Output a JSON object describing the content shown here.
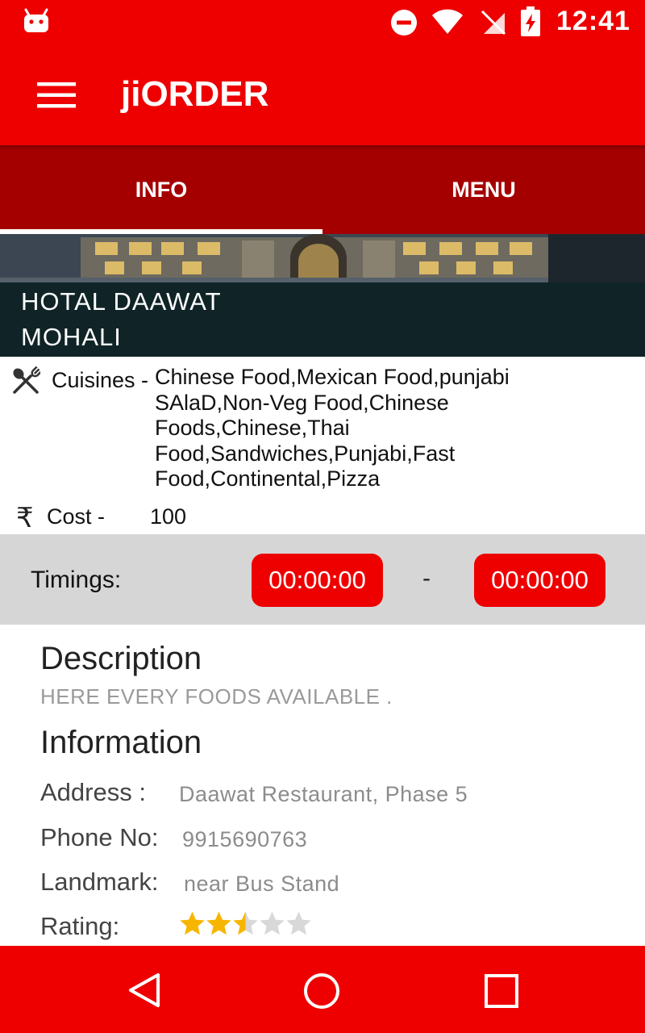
{
  "status_bar": {
    "time": "12:41",
    "icons": [
      "android-icon",
      "do-not-disturb-icon",
      "wifi-icon",
      "no-signal-icon",
      "battery-charging-icon"
    ]
  },
  "app_bar": {
    "title": "jiORDER",
    "menu_icon": "hamburger-menu-icon"
  },
  "tabs": {
    "items": [
      {
        "label": "INFO",
        "selected": true
      },
      {
        "label": "MENU",
        "selected": false
      }
    ]
  },
  "hero": {
    "title_line1": "HOTAL DAAWAT",
    "title_line2": "MOHALI"
  },
  "details": {
    "cuisines_label": "Cuisines -",
    "cuisines_value": "Chinese Food,Mexican Food,punjabi SAlaD,Non-Veg Food,Chinese Foods,Chinese,Thai Food,Sandwiches,Punjabi,Fast Food,Continental,Pizza",
    "cost_symbol": "₹",
    "cost_label": "Cost -",
    "cost_value": "100"
  },
  "timings": {
    "label": "Timings:",
    "start": "00:00:00",
    "separator": "-",
    "end": "00:00:00"
  },
  "description": {
    "title": "Description",
    "text": "HERE EVERY FOODS AVAILABLE ."
  },
  "information": {
    "title": "Information",
    "address_label": "Address :",
    "address_value": "Daawat Restaurant, Phase 5",
    "phone_label": "Phone No:",
    "phone_value": "9915690763",
    "landmark_label": "Landmark:",
    "landmark_value": "near Bus Stand",
    "rating_label": "Rating:",
    "rating_value": 2.5,
    "rating_max": 5
  },
  "colors": {
    "primary": "#ee0000",
    "tab_bar": "#a50000",
    "timings_bg": "#d6d6d6",
    "star_filled": "#f7b500",
    "star_empty": "#d8d8d8"
  },
  "nav_bar": {
    "icons": [
      "back-icon",
      "home-icon",
      "recents-icon"
    ]
  }
}
